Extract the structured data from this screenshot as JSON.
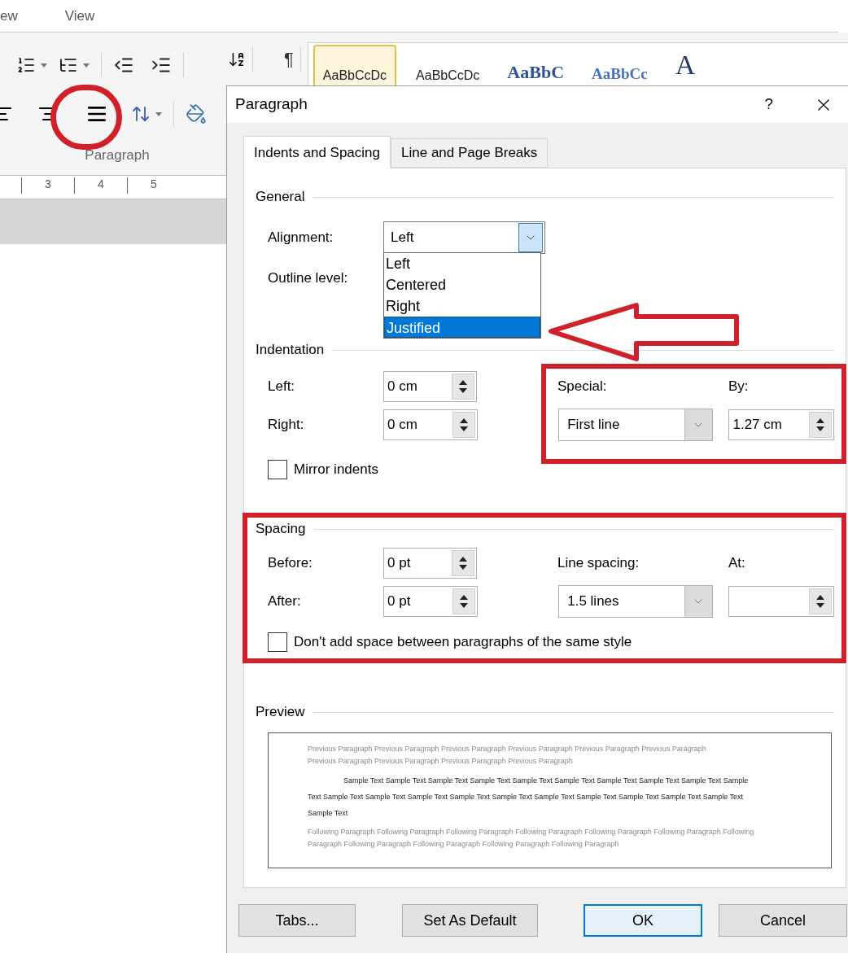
{
  "ribbon": {
    "tabs": [
      {
        "label": "ew"
      },
      {
        "label": "View"
      }
    ],
    "pilcrow": "¶",
    "group_label": "Paragraph",
    "ruler_numbers": [
      "3",
      "4",
      "5"
    ],
    "styles_gallery": [
      {
        "sample": "AaBbCcDc",
        "kind": "normal",
        "selected": true
      },
      {
        "sample": "AaBbCcDc",
        "kind": "normal",
        "selected": false
      },
      {
        "sample": "AaBbC",
        "kind": "heading1",
        "selected": false
      },
      {
        "sample": "AaBbCc",
        "kind": "heading2",
        "selected": false
      },
      {
        "sample": "A",
        "kind": "title",
        "selected": false
      }
    ]
  },
  "dialog": {
    "title": "Paragraph",
    "help": "?",
    "tabs": [
      {
        "label": "Indents and Spacing",
        "selected": true
      },
      {
        "label": "Line and Page Breaks",
        "selected": false
      }
    ],
    "general": {
      "heading": "General",
      "alignment_label": "Alignment:",
      "alignment_value": "Left",
      "outline_label": "Outline level:",
      "alignment_options": [
        {
          "label": "Left",
          "selected": false
        },
        {
          "label": "Centered",
          "selected": false
        },
        {
          "label": "Right",
          "selected": false
        },
        {
          "label": "Justified",
          "selected": true
        }
      ]
    },
    "indentation": {
      "heading": "Indentation",
      "left_label": "Left:",
      "left_value": "0 cm",
      "right_label": "Right:",
      "right_value": "0 cm",
      "special_label": "Special:",
      "special_value": "First line",
      "by_label": "By:",
      "by_value": "1.27 cm",
      "mirror_label": "Mirror indents",
      "mirror_checked": false
    },
    "spacing": {
      "heading": "Spacing",
      "before_label": "Before:",
      "before_value": "0 pt",
      "after_label": "After:",
      "after_value": "0 pt",
      "line_spacing_label": "Line spacing:",
      "line_spacing_value": "1.5 lines",
      "at_label": "At:",
      "dont_add_label": "Don't add space between paragraphs of the same style",
      "dont_add_checked": false
    },
    "preview": {
      "heading": "Preview",
      "previous": "Previous Paragraph Previous Paragraph Previous Paragraph Previous Paragraph Previous Paragraph Previous Paragraph Previous Paragraph Previous Paragraph Previous Paragraph Previous Paragraph",
      "sample": "Sample Text Sample Text Sample Text Sample Text Sample Text Sample Text Sample Text Sample Text Sample Text Sample Text Sample Text Sample Text Sample Text Sample Text Sample Text Sample Text Sample Text Sample Text Sample Text Sample Text Sample Text",
      "following": "Following Paragraph Following Paragraph Following Paragraph Following Paragraph Following Paragraph Following Paragraph Following Paragraph Following Paragraph Following Paragraph Following Paragraph Following Paragraph"
    },
    "buttons": [
      {
        "label": "Tabs...",
        "default": false
      },
      {
        "label": "Set As Default",
        "default": false
      },
      {
        "label": "OK",
        "default": true
      },
      {
        "label": "Cancel",
        "default": false
      }
    ]
  }
}
